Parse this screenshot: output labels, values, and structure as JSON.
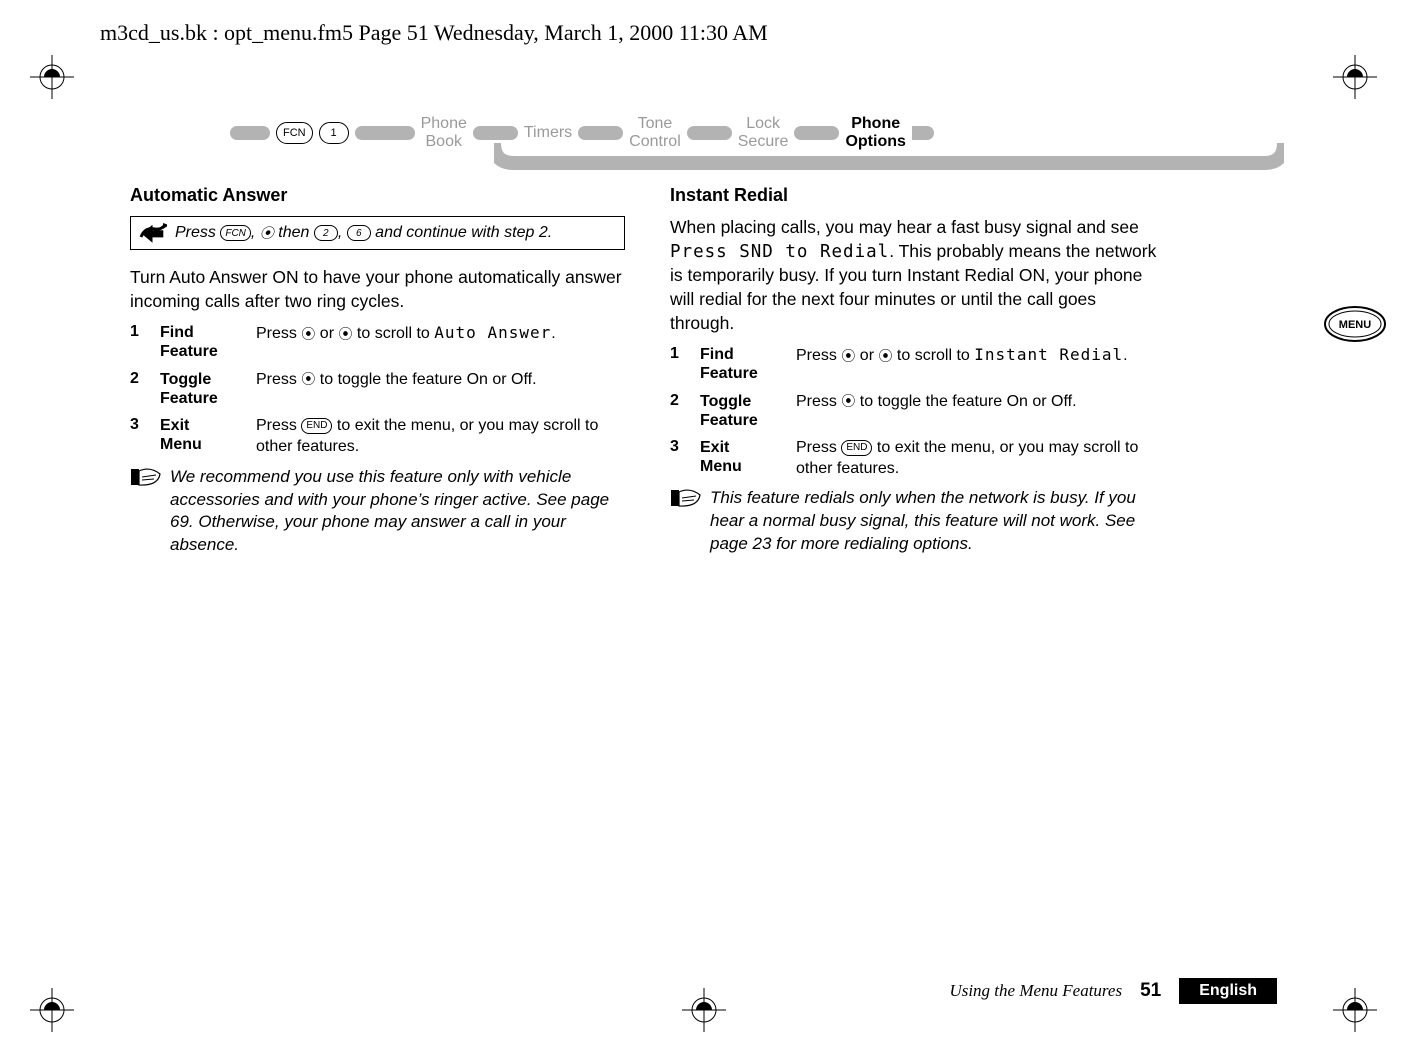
{
  "header_line": "m3cd_us.bk : opt_menu.fm5  Page 51  Wednesday, March 1, 2000  11:30 AM",
  "nav": {
    "fcn": "FCN",
    "key1": "1",
    "phone_book_l1": "Phone",
    "phone_book_l2": "Book",
    "timers": "Timers",
    "tone_l1": "Tone",
    "tone_l2": "Control",
    "lock_l1": "Lock",
    "lock_l2": "Secure",
    "options_l1": "Phone",
    "options_l2": "Options"
  },
  "left": {
    "title": "Automatic Answer",
    "shortcut_prefix": "Press ",
    "shortcut_fcn": "FCN",
    "shortcut_mid1": ", ",
    "shortcut_mid2": " then ",
    "shortcut_k2": "2",
    "shortcut_mid3": ", ",
    "shortcut_k6": "6",
    "shortcut_end": " and continue with step 2.",
    "body": "Turn Auto Answer ON to have your phone automatically answer incoming calls after two ring cycles.",
    "step1_num": "1",
    "step1_label_l1": "Find",
    "step1_label_l2": "Feature",
    "step1_text_a": "Press ",
    "step1_text_b": " or ",
    "step1_text_c": " to scroll to ",
    "step1_lcd": "Auto Answer",
    "step1_text_d": ".",
    "step2_num": "2",
    "step2_label_l1": "Toggle",
    "step2_label_l2": "Feature",
    "step2_text_a": "Press ",
    "step2_text_b": " to toggle the feature On or Off.",
    "step3_num": "3",
    "step3_label_l1": "Exit",
    "step3_label_l2": "Menu",
    "step3_text_a": "Press ",
    "step3_end": "END",
    "step3_text_b": " to exit the menu, or you may scroll to other features.",
    "note": "We recommend you use this feature only with vehicle accessories and with your phone’s ringer active. See page 69. Otherwise, your phone may answer a call in your absence."
  },
  "right": {
    "title": "Instant Redial",
    "body_a": "When placing calls, you may hear a fast busy signal and see ",
    "body_lcd": "Press SND to Redial",
    "body_b": ". This probably means the network is temporarily busy. If you turn Instant Redial ON, your phone will redial for the next four minutes or until the call goes through.",
    "step1_num": "1",
    "step1_label_l1": "Find",
    "step1_label_l2": "Feature",
    "step1_text_a": "Press ",
    "step1_text_b": " or ",
    "step1_text_c": " to scroll to ",
    "step1_lcd": "Instant Redial",
    "step1_text_d": ".",
    "step2_num": "2",
    "step2_label_l1": "Toggle",
    "step2_label_l2": "Feature",
    "step2_text_a": "Press ",
    "step2_text_b": " to toggle the feature On or Off.",
    "step3_num": "3",
    "step3_label_l1": "Exit",
    "step3_label_l2": "Menu",
    "step3_text_a": "Press ",
    "step3_end": "END",
    "step3_text_b": " to exit the menu, or you may scroll to other features.",
    "note": "This feature redials only when the network is busy. If you hear a normal busy signal, this feature will not work. See page 23 for more redialing options."
  },
  "menu_tab": "MENU",
  "footer": {
    "title": "Using the Menu Features",
    "num": "51",
    "lang": "English"
  }
}
